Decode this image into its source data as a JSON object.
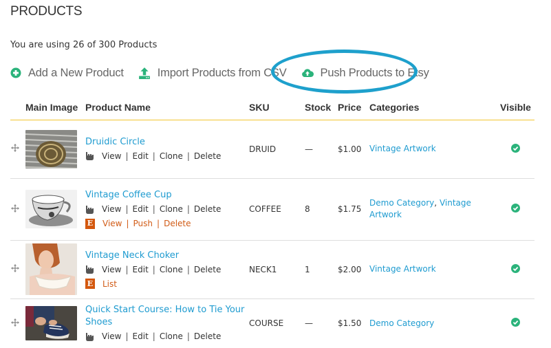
{
  "page": {
    "title": "PRODUCTS",
    "usage_text": "You are using 26 of 300 Products"
  },
  "actions": [
    {
      "label": "Add a New Product",
      "icon": "plus-circle-icon"
    },
    {
      "label": "Import Products from CSV",
      "icon": "upload-icon"
    },
    {
      "label": "Push Products to Etsy",
      "icon": "cloud-upload-icon",
      "highlighted": true
    }
  ],
  "colors": {
    "accent_green": "#2bb37b",
    "link_blue": "#1e9bd0",
    "etsy_orange": "#d4580e",
    "header_rule": "#f2c530",
    "highlight_ring": "#1ea0cc"
  },
  "table": {
    "headers": [
      "Main Image",
      "Product Name",
      "SKU",
      "Stock",
      "Price",
      "Categories",
      "Visible"
    ],
    "row_link_labels": {
      "view": "View",
      "edit": "Edit",
      "clone": "Clone",
      "delete": "Delete"
    },
    "rows": [
      {
        "name": "Druidic Circle",
        "sku": "DRUID",
        "stock": "—",
        "price": "$1.00",
        "categories": [
          "Vintage Artwork"
        ],
        "visible": true,
        "etsy_links": []
      },
      {
        "name": "Vintage Coffee Cup",
        "sku": "COFFEE",
        "stock": "8",
        "price": "$1.75",
        "categories": [
          "Demo Category",
          "Vintage Artwork"
        ],
        "visible": true,
        "etsy_links": [
          "View",
          "Push",
          "Delete"
        ]
      },
      {
        "name": "Vintage Neck Choker",
        "sku": "NECK1",
        "stock": "1",
        "price": "$2.00",
        "categories": [
          "Vintage Artwork"
        ],
        "visible": true,
        "etsy_links": [
          "List"
        ]
      },
      {
        "name": "Quick Start Course: How to Tie Your Shoes",
        "sku": "COURSE",
        "stock": "—",
        "price": "$1.50",
        "categories": [
          "Demo Category"
        ],
        "visible": true,
        "etsy_links": []
      }
    ]
  },
  "etsy": {
    "badge_letter": "E"
  }
}
